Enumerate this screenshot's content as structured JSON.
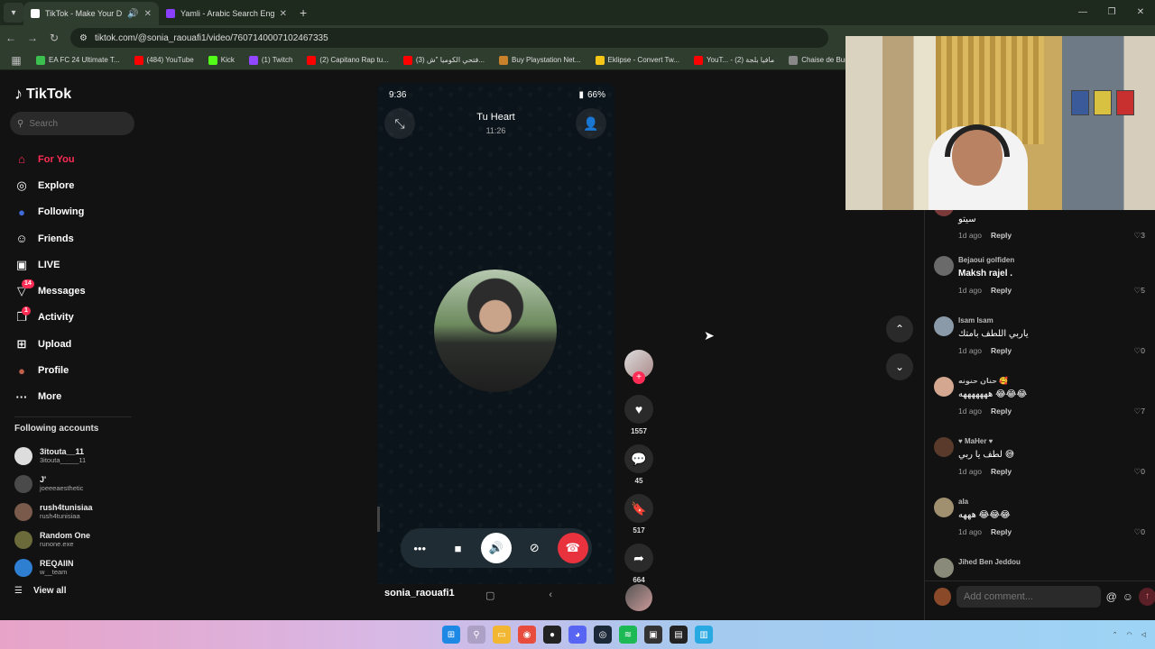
{
  "browser": {
    "tabs": [
      {
        "title": "TikTok - Make Your Day",
        "active": true
      },
      {
        "title": "Yamli - Arabic Search Engine and",
        "active": false
      }
    ],
    "url": "tiktok.com/@sonia_raouafi1/video/7607140007102467335",
    "bookmarks": [
      "EA FC 24 Ultimate T...",
      "(484) YouTube",
      "Kick",
      "(1) Twitch",
      "(2) Capitano Rap tu...",
      "(3) فتحي الكوميا \"ش...",
      "Buy Playstation Net...",
      "Eklipse - Convert Tw...",
      "YouT... - مافيا بلجة (2)",
      "Chaise de Bureau F..."
    ]
  },
  "sidebar": {
    "logo": "TikTok",
    "search_placeholder": "Search",
    "nav": [
      {
        "label": "For You",
        "icon": "home-icon",
        "glyph": "⌂",
        "active": true
      },
      {
        "label": "Explore",
        "icon": "compass-icon",
        "glyph": "◎"
      },
      {
        "label": "Following",
        "icon": "following-avatar-icon",
        "glyph": "●"
      },
      {
        "label": "Friends",
        "icon": "friends-icon",
        "glyph": "☺"
      },
      {
        "label": "LIVE",
        "icon": "live-icon",
        "glyph": "▣"
      },
      {
        "label": "Messages",
        "icon": "messages-icon",
        "glyph": "▽",
        "badge": "14"
      },
      {
        "label": "Activity",
        "icon": "activity-icon",
        "glyph": "❐",
        "badge": "1"
      },
      {
        "label": "Upload",
        "icon": "upload-icon",
        "glyph": "⊞"
      },
      {
        "label": "Profile",
        "icon": "profile-avatar-icon",
        "glyph": "●"
      },
      {
        "label": "More",
        "icon": "more-icon",
        "glyph": "···"
      }
    ],
    "following_title": "Following accounts",
    "following": [
      {
        "name": "3itouta__11",
        "handle": "3itouta_____11"
      },
      {
        "name": "J'",
        "handle": "joeeeaesthetic"
      },
      {
        "name": "rush4tunisiaa",
        "handle": "rush4tunisiaa"
      },
      {
        "name": "Random One",
        "handle": "runone.exe"
      },
      {
        "name": "REQAIIN",
        "handle": "w__team"
      }
    ],
    "view_all": "View all"
  },
  "video": {
    "status_time": "9:36",
    "battery": "66%",
    "call_name": "Tu Heart",
    "call_duration": "11:26",
    "username": "sonia_raouafi1"
  },
  "actions": {
    "likes": "1557",
    "comments": "45",
    "saves": "517",
    "shares": "664"
  },
  "comments": [
    {
      "name": "",
      "text": "سيتو",
      "time": "1d ago",
      "likes": "3"
    },
    {
      "name": "Bejaoui golfiden",
      "text": "Maksh rajel .",
      "time": "1d ago",
      "likes": "5"
    },
    {
      "name": "Isam Isam",
      "text": "ياربي اللطف بامتك",
      "time": "1d ago",
      "likes": "0"
    },
    {
      "name": "حنان حنونه 🥰",
      "text": "هههههههه 😂😂😂",
      "time": "1d ago",
      "likes": "7"
    },
    {
      "name": "♥ MaHer ♥",
      "text": "لطف يا ربي 😅",
      "time": "1d ago",
      "likes": "0"
    },
    {
      "name": "ala",
      "text": "هههه 😂😂😂",
      "time": "1d ago",
      "likes": "0"
    },
    {
      "name": "Jihed Ben Jeddou",
      "text": "",
      "time": "",
      "likes": ""
    }
  ],
  "comment_reply_label": "Reply",
  "comment_input_placeholder": "Add comment..."
}
